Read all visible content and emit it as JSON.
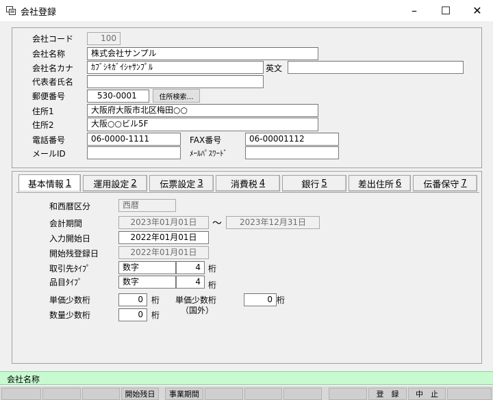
{
  "window": {
    "title": "会社登録",
    "minimize": "–",
    "maximize": "☐",
    "close": "✕"
  },
  "company": {
    "code_label": "会社コード",
    "code_value": "100",
    "name_label": "会社名称",
    "name_value": "株式会社サンプル",
    "kana_label": "会社名カナ",
    "kana_value": "ｶﾌﾞｼｷｶﾞｲｼｬｻﾝﾌﾟﾙ",
    "english_label": "英文",
    "english_value": "",
    "rep_label": "代表者氏名",
    "rep_value": "",
    "zip_label": "郵便番号",
    "zip_value": "530-0001",
    "addr_search_label": "住所検索…",
    "addr1_label": "住所1",
    "addr1_value": "大阪府大阪市北区梅田○○",
    "addr2_label": "住所2",
    "addr2_value": "大阪○○ビル5F",
    "addr3_value": "",
    "tel_label": "電話番号",
    "tel_value": "06-0000-1111",
    "fax_label": "FAX番号",
    "fax_value": "06-00001112",
    "mail_label": "メールID",
    "mail_value": "",
    "mailpw_label": "ﾒｰﾙﾊﾟｽﾜｰﾄﾞ",
    "mailpw_value": ""
  },
  "tabs": [
    {
      "label": "基本情報",
      "key": "1"
    },
    {
      "label": "運用設定",
      "key": "2"
    },
    {
      "label": "伝票設定",
      "key": "3"
    },
    {
      "label": "消費税",
      "key": "4"
    },
    {
      "label": "銀行",
      "key": "5"
    },
    {
      "label": "差出住所",
      "key": "6"
    },
    {
      "label": "伝番保守",
      "key": "7"
    }
  ],
  "basic": {
    "era_label": "和西暦区分",
    "era_value": "西暦",
    "period_label": "会計期間",
    "period_from": "2023年01月01日",
    "period_tilde": "～",
    "period_to": "2023年12月31日",
    "input_start_label": "入力開始日",
    "input_start_value": "2022年01月01日",
    "opening_label": "開始残登録日",
    "opening_value": "2022年01月01日",
    "partner_type_label": "取引先ﾀｲﾌﾟ",
    "partner_type_value": "数字",
    "partner_digits": "4",
    "partner_unit": "桁",
    "item_type_label": "品目ﾀｲﾌﾟ",
    "item_type_value": "数字",
    "item_digits": "4",
    "item_unit": "桁",
    "unit_price_dec_label": "単価少数桁",
    "unit_price_dec_value": "0",
    "unit_price_dec_unit": "桁",
    "foreign_price_label": "単価少数桁",
    "foreign_price_sub": "（国外）",
    "foreign_price_value": "0",
    "foreign_price_unit": "桁",
    "qty_dec_label": "数量少数桁",
    "qty_dec_value": "0",
    "qty_dec_unit": "桁"
  },
  "status": {
    "text": "会社名称"
  },
  "fkeys": {
    "f5": "開始残日",
    "f6": "事業期間",
    "f11": "登　録",
    "f12": "中　止"
  }
}
